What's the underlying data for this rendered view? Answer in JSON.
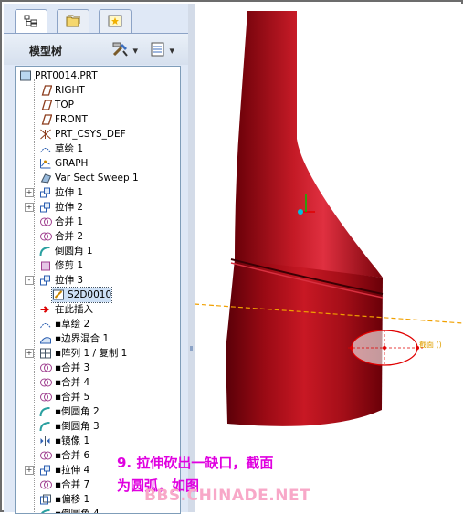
{
  "tabs": [
    {
      "name": "tab-model-tree",
      "icon": "model-tree-icon"
    },
    {
      "name": "tab-folder-browser",
      "icon": "folder-icon"
    },
    {
      "name": "tab-favorites",
      "icon": "favorites-icon"
    }
  ],
  "header": {
    "title": "模型树",
    "settings_icon": "tools-icon",
    "show_icon": "list-icon",
    "dropdown": "▾"
  },
  "tree": {
    "items": [
      {
        "label": "PRT0014.PRT",
        "icon": "part-icon",
        "indent": 0,
        "expand": ""
      },
      {
        "label": "RIGHT",
        "icon": "datum-plane-icon",
        "indent": 1,
        "expand": ""
      },
      {
        "label": "TOP",
        "icon": "datum-plane-icon",
        "indent": 1,
        "expand": ""
      },
      {
        "label": "FRONT",
        "icon": "datum-plane-icon",
        "indent": 1,
        "expand": ""
      },
      {
        "label": "PRT_CSYS_DEF",
        "icon": "csys-icon",
        "indent": 1,
        "expand": ""
      },
      {
        "label": "草绘 1",
        "icon": "sketch-icon",
        "indent": 1,
        "expand": ""
      },
      {
        "label": "GRAPH",
        "icon": "graph-icon",
        "indent": 1,
        "expand": ""
      },
      {
        "label": "Var Sect Sweep 1",
        "icon": "sweep-icon",
        "indent": 1,
        "expand": ""
      },
      {
        "label": "拉伸 1",
        "icon": "extrude-icon",
        "indent": 1,
        "expand": "+"
      },
      {
        "label": "拉伸 2",
        "icon": "extrude-icon",
        "indent": 1,
        "expand": "+"
      },
      {
        "label": "合并 1",
        "icon": "merge-icon",
        "indent": 1,
        "expand": ""
      },
      {
        "label": "合并 2",
        "icon": "merge-icon",
        "indent": 1,
        "expand": ""
      },
      {
        "label": "倒圆角 1",
        "icon": "round-icon",
        "indent": 1,
        "expand": ""
      },
      {
        "label": "修剪 1",
        "icon": "trim-icon",
        "indent": 1,
        "expand": ""
      },
      {
        "label": "拉伸 3",
        "icon": "extrude-icon",
        "indent": 1,
        "expand": "-"
      },
      {
        "label": "S2D0010",
        "icon": "section-icon",
        "indent": 2,
        "expand": "",
        "selected": true
      },
      {
        "label": "在此插入",
        "icon": "insert-here-icon",
        "indent": 1,
        "expand": ""
      },
      {
        "label": "▪草绘 2",
        "icon": "sketch-icon",
        "indent": 1,
        "expand": ""
      },
      {
        "label": "▪边界混合 1",
        "icon": "boundary-blend-icon",
        "indent": 1,
        "expand": ""
      },
      {
        "label": "▪阵列 1 / 复制 1",
        "icon": "pattern-icon",
        "indent": 1,
        "expand": "+"
      },
      {
        "label": "▪合并 3",
        "icon": "merge-icon",
        "indent": 1,
        "expand": ""
      },
      {
        "label": "▪合并 4",
        "icon": "merge-icon",
        "indent": 1,
        "expand": ""
      },
      {
        "label": "▪合并 5",
        "icon": "merge-icon",
        "indent": 1,
        "expand": ""
      },
      {
        "label": "▪倒圆角 2",
        "icon": "round-icon",
        "indent": 1,
        "expand": ""
      },
      {
        "label": "▪倒圆角 3",
        "icon": "round-icon",
        "indent": 1,
        "expand": ""
      },
      {
        "label": "▪镜像 1",
        "icon": "mirror-icon",
        "indent": 1,
        "expand": ""
      },
      {
        "label": "▪合并 6",
        "icon": "merge-icon",
        "indent": 1,
        "expand": ""
      },
      {
        "label": "▪拉伸 4",
        "icon": "extrude-icon",
        "indent": 1,
        "expand": "+"
      },
      {
        "label": "▪合并 7",
        "icon": "merge-icon",
        "indent": 1,
        "expand": ""
      },
      {
        "label": "▪偏移 1",
        "icon": "offset-icon",
        "indent": 1,
        "expand": ""
      },
      {
        "label": "▪倒圆角 4",
        "icon": "round-icon",
        "indent": 1,
        "expand": ""
      }
    ]
  },
  "viewport": {
    "dim_label": "截面 ()",
    "model_color": "#b0101a",
    "highlight_color": "#e00000",
    "axis_color": "#f0a000"
  },
  "caption": {
    "line1": "9. 拉伸砍出一缺口，截面",
    "line2": "为圆弧，如图"
  },
  "watermark": "BBS.CHINADE.NET"
}
